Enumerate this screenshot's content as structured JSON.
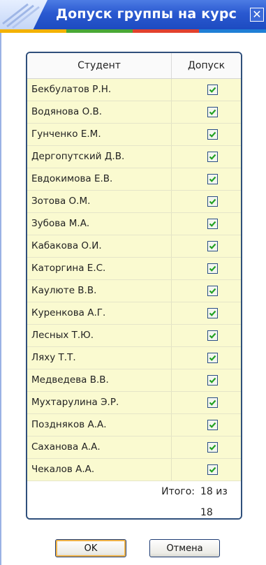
{
  "window": {
    "title": "Допуск группы  на курс",
    "close_glyph": "✕"
  },
  "table": {
    "columns": [
      "Студент",
      "Допуск"
    ],
    "rows": [
      {
        "name": "Бекбулатов Р.Н.",
        "admitted": true
      },
      {
        "name": "Водянова О.В.",
        "admitted": true
      },
      {
        "name": "Гунченко Е.М.",
        "admitted": true
      },
      {
        "name": "Дергопутский Д.В.",
        "admitted": true
      },
      {
        "name": "Евдокимова Е.В.",
        "admitted": true
      },
      {
        "name": "Зотова О.М.",
        "admitted": true
      },
      {
        "name": "Зубова М.А.",
        "admitted": true
      },
      {
        "name": "Кабакова О.И.",
        "admitted": true
      },
      {
        "name": "Каторгина Е.С.",
        "admitted": true
      },
      {
        "name": "Каулюте В.В.",
        "admitted": true
      },
      {
        "name": "Куренкова А.Г.",
        "admitted": true
      },
      {
        "name": "Лесных Т.Ю.",
        "admitted": true
      },
      {
        "name": "Ляху Т.Т.",
        "admitted": true
      },
      {
        "name": "Медведева В.В.",
        "admitted": true
      },
      {
        "name": "Мухтарулина Э.Р.",
        "admitted": true
      },
      {
        "name": "Поздняков А.А.",
        "admitted": true
      },
      {
        "name": "Саханова А.А.",
        "admitted": true
      },
      {
        "name": "Чекалов А.А.",
        "admitted": true
      }
    ],
    "total_label": "Итого:",
    "total_value": "18 из 18"
  },
  "buttons": {
    "ok": "OK",
    "cancel": "Отмена"
  },
  "colors": {
    "titlebar": "#2a59d0",
    "row_bg": "#fafad0",
    "panel_border": "#2f4f7b",
    "checkmark": "#21a121"
  }
}
